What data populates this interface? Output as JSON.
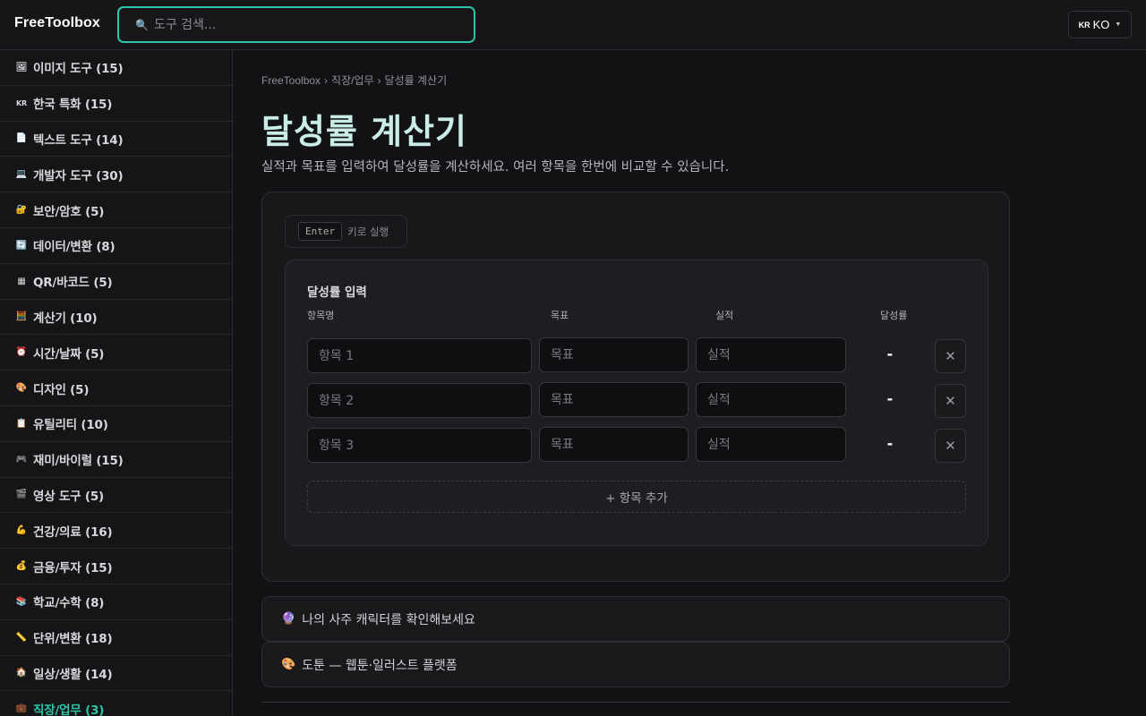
{
  "header": {
    "logo": "FreeToolbox",
    "search_placeholder": "도구 검색...",
    "lang_flag": "KR",
    "lang_label": "KO"
  },
  "sidebar": {
    "items": [
      {
        "label": "이미지 도구 (15)",
        "icon": "image-icon",
        "glyph": "🖼",
        "active": false
      },
      {
        "label": "한국 특화 (15)",
        "icon": "kr-flag-icon",
        "glyph": "KR",
        "active": false
      },
      {
        "label": "텍스트 도구 (14)",
        "icon": "document-icon",
        "glyph": "📄",
        "active": false
      },
      {
        "label": "개발자 도구 (30)",
        "icon": "laptop-icon",
        "glyph": "💻",
        "active": false
      },
      {
        "label": "보안/암호 (5)",
        "icon": "lock-icon",
        "glyph": "🔐",
        "active": false
      },
      {
        "label": "데이터/변환 (8)",
        "icon": "refresh-icon",
        "glyph": "🔄",
        "active": false
      },
      {
        "label": "QR/바코드 (5)",
        "icon": "qr-icon",
        "glyph": "▦",
        "active": false
      },
      {
        "label": "계산기 (10)",
        "icon": "calculator-icon",
        "glyph": "🧮",
        "active": false
      },
      {
        "label": "시간/날짜 (5)",
        "icon": "clock-icon",
        "glyph": "⏰",
        "active": false
      },
      {
        "label": "디자인 (5)",
        "icon": "palette-icon",
        "glyph": "🎨",
        "active": false
      },
      {
        "label": "유틸리티 (10)",
        "icon": "clipboard-icon",
        "glyph": "📋",
        "active": false
      },
      {
        "label": "재미/바이럴 (15)",
        "icon": "gamepad-icon",
        "glyph": "🎮",
        "active": false
      },
      {
        "label": "영상 도구 (5)",
        "icon": "clapper-icon",
        "glyph": "🎬",
        "active": false
      },
      {
        "label": "건강/의료 (16)",
        "icon": "muscle-icon",
        "glyph": "💪",
        "active": false
      },
      {
        "label": "금융/투자 (15)",
        "icon": "moneybag-icon",
        "glyph": "💰",
        "active": false
      },
      {
        "label": "학교/수학 (8)",
        "icon": "books-icon",
        "glyph": "📚",
        "active": false
      },
      {
        "label": "단위/변환 (18)",
        "icon": "ruler-icon",
        "glyph": "📏",
        "active": false
      },
      {
        "label": "일상/생활 (14)",
        "icon": "house-icon",
        "glyph": "🏠",
        "active": false
      },
      {
        "label": "직장/업무 (3)",
        "icon": "briefcase-icon",
        "glyph": "💼",
        "active": true
      }
    ]
  },
  "main": {
    "breadcrumb": [
      "FreeToolbox",
      "직장/업무",
      "달성률 계산기"
    ],
    "breadcrumb_sep": "›",
    "title": "달성률 계산기",
    "description": "실적과 목표를 입력하여 달성률을 계산하세요. 여러 항목을 한번에 비교할 수 있습니다.",
    "enter_hint": {
      "key": "Enter",
      "text": "키로 실행"
    },
    "panel": {
      "title": "달성률 입력",
      "columns": {
        "name": "항목명",
        "target": "목표",
        "actual": "실적",
        "rate": "달성률"
      },
      "rows": [
        {
          "name_placeholder": "항목 1",
          "target_placeholder": "목표",
          "actual_placeholder": "실적",
          "rate": "-"
        },
        {
          "name_placeholder": "항목 2",
          "target_placeholder": "목표",
          "actual_placeholder": "실적",
          "rate": "-"
        },
        {
          "name_placeholder": "항목 3",
          "target_placeholder": "목표",
          "actual_placeholder": "실적",
          "rate": "-"
        }
      ],
      "delete_glyph": "✕",
      "add_label": "+ 항목 추가"
    },
    "banners": [
      {
        "icon": "fortune-teller-icon",
        "glyph": "🔮",
        "label": "나의 사주 캐릭터를 확인해보세요"
      },
      {
        "icon": "palette-icon",
        "glyph": "🎨",
        "label": "도툰 — 웹툰·일러스트 플랫폼"
      }
    ]
  },
  "colors": {
    "accent": "#2ec4a8",
    "title": "#c9ece6",
    "background": "#121214"
  }
}
